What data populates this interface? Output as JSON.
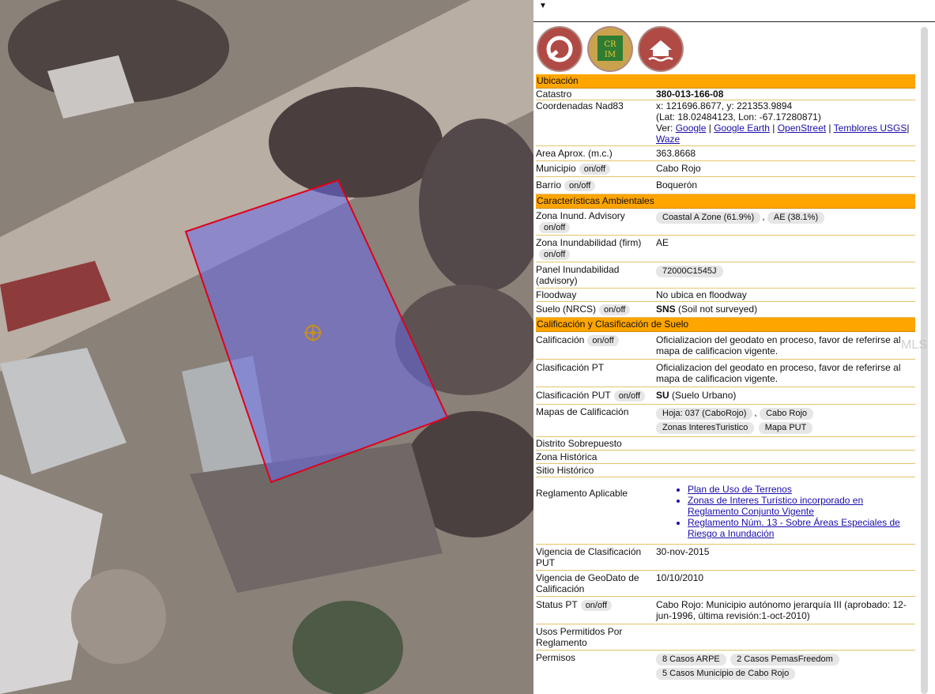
{
  "watermark": "MLS",
  "sections": {
    "ubicacion": "Ubicación",
    "ambientales": "Características Ambientales",
    "calificacion": "Calificación y Clasificación de Suelo"
  },
  "toggle_label": "on/off",
  "ubicacion": {
    "catastro_label": "Catastro",
    "catastro_value": "380-013-166-08",
    "coords_label": "Coordenadas Nad83",
    "coords_xy": "x: 121696.8677, y: 221353.9894",
    "coords_latlon": "(Lat: 18.02484123, Lon: -67.17280871)",
    "ver_label": "Ver:",
    "links": [
      "Google",
      "Google Earth",
      "OpenStreet",
      "Temblores USGS",
      "Waze"
    ],
    "area_label": "Area Aprox. (m.c.)",
    "area_value": "363.8668",
    "municipio_label": "Municipio",
    "municipio_value": "Cabo Rojo",
    "barrio_label": "Barrio",
    "barrio_value": "Boquerón"
  },
  "ambientales": {
    "zona_adv_label": "Zona Inund. Advisory",
    "zona_adv_values": [
      "Coastal A Zone (61.9%)",
      "AE (38.1%)"
    ],
    "zona_firm_label": "Zona Inundabilidad (firm)",
    "zona_firm_value": "AE",
    "panel_label": "Panel Inundabilidad (advisory)",
    "panel_value": "72000C1545J",
    "floodway_label": "Floodway",
    "floodway_value": "No ubica en floodway",
    "suelo_label": "Suelo (NRCS)",
    "suelo_code": "SNS",
    "suelo_desc": "(Soil not surveyed)"
  },
  "calificacion": {
    "calif_label": "Calificación",
    "calif_value": "Oficializacion del geodato en proceso, favor de referirse al mapa de calificacion vigente.",
    "clasif_pt_label": "Clasificación PT",
    "clasif_pt_value": "Oficializacion del geodato en proceso, favor de referirse al mapa de calificacion vigente.",
    "clasif_put_label": "Clasificación PUT",
    "clasif_put_code": "SU",
    "clasif_put_desc": "(Suelo Urbano)",
    "mapas_label": "Mapas de Calificación",
    "mapas_values": [
      "Hoja: 037 (CaboRojo)",
      "Cabo Rojo",
      "Zonas InteresTuristico",
      "Mapa PUT"
    ],
    "distrito_label": "Distrito Sobrepuesto",
    "zona_hist_label": "Zona Histórica",
    "sitio_hist_label": "Sitio Histórico",
    "reglamento_label": "Reglamento Aplicable",
    "reglamento_links": [
      "Plan de Uso de Terrenos",
      "Zonas de Interes Turístico incorporado en Reglamento Conjunto Vigente",
      "Reglamento Núm. 13 - Sobre Áreas Especiales de Riesgo a Inundación"
    ],
    "vig_clasif_label": "Vigencia de Clasificación PUT",
    "vig_clasif_value": "30-nov-2015",
    "vig_geo_label": "Vigencia de GeoDato de Calificación",
    "vig_geo_value": "10/10/2010",
    "status_label": "Status PT",
    "status_value": "Cabo Rojo: Municipio autónomo jerarquía III (aprobado: 12-jun-1996, última revisión:1-oct-2010)",
    "usos_label": "Usos Permitidos Por Reglamento",
    "permisos_label": "Permisos",
    "permisos_values": [
      "8 Casos ARPE",
      "2 Casos PemasFreedom",
      "5 Casos Municipio de Cabo Rojo"
    ]
  },
  "icons": [
    "geo-tool-icon",
    "crim-logo-icon",
    "flood-house-icon"
  ],
  "colors": {
    "section_bg": "#ffa500",
    "parcel_outline": "#e0001a",
    "parcel_fill": "#6a6ae8"
  }
}
